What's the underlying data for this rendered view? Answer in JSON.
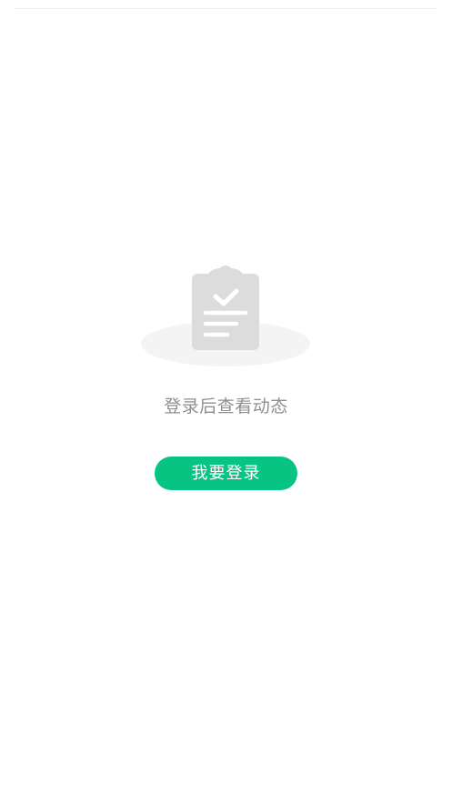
{
  "empty_state": {
    "icon": "clipboard-check-icon",
    "message": "登录后查看动态"
  },
  "actions": {
    "login_label": "我要登录"
  },
  "colors": {
    "accent": "#07c483",
    "message_text": "#8f8f8f",
    "illustration": "#dcdcdc",
    "illustration_shadow": "#f4f4f4"
  }
}
